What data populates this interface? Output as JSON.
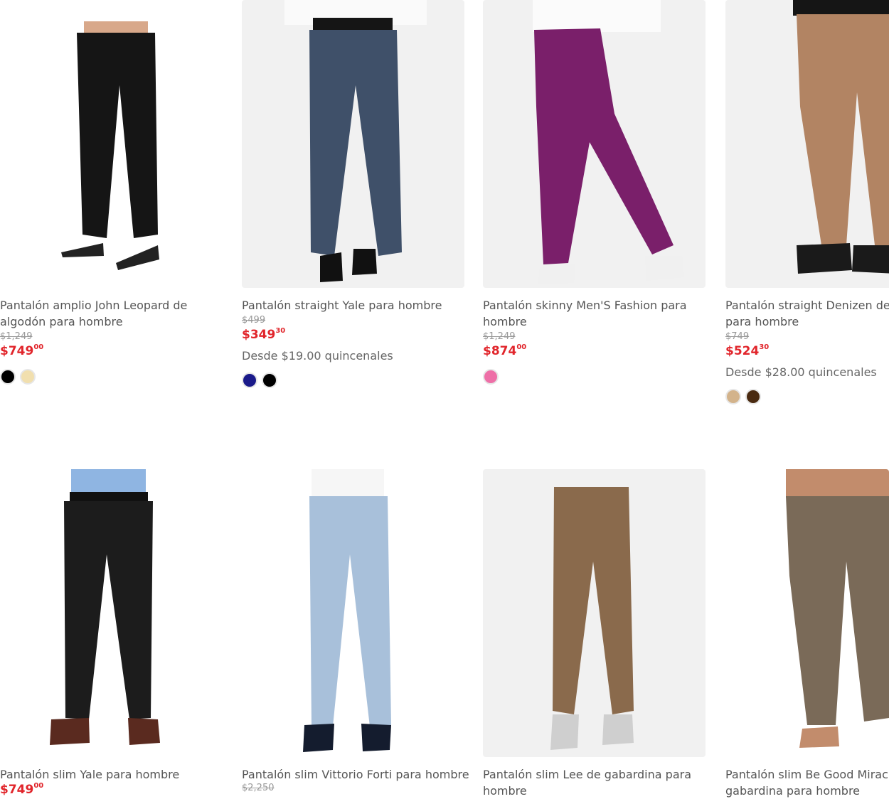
{
  "products": [
    {
      "title_line1": "Pantalón amplio John Leopard de",
      "title_line2": "algodón para hombre",
      "old_price": "$1,249",
      "price_main": "$749",
      "price_cents": "00",
      "installments": "",
      "swatches": [
        "#000000",
        "#f1dfae"
      ],
      "pants_color": "#151515"
    },
    {
      "title_line1": "Pantalón straight Yale para hombre",
      "title_line2": "",
      "old_price": "$499",
      "price_main": "$349",
      "price_cents": "30",
      "installments": "Desde $19.00 quincenales",
      "swatches": [
        "#1a1a8a",
        "#000000"
      ],
      "pants_color": "#3f5069"
    },
    {
      "title_line1": "Pantalón skinny Men'S Fashion para",
      "title_line2": "hombre",
      "old_price": "$1,249",
      "price_main": "$874",
      "price_cents": "00",
      "installments": "",
      "swatches": [
        "#ee6fa7"
      ],
      "pants_color": "#7a1f6a"
    },
    {
      "title_line1": "Pantalón straight Denizen de g",
      "title_line2": "para hombre",
      "old_price": "$749",
      "price_main": "$524",
      "price_cents": "30",
      "installments": "Desde $28.00 quincenales",
      "swatches": [
        "#d3b38b",
        "#4a2a10"
      ],
      "pants_color": "#b28463"
    },
    {
      "title_line1": "Pantalón slim Yale para hombre",
      "title_line2": "",
      "old_price": "",
      "price_main": "$749",
      "price_cents": "00",
      "installments": "",
      "swatches": [],
      "pants_color": "#1c1c1c"
    },
    {
      "title_line1": "Pantalón slim Vittorio Forti para hombre",
      "title_line2": "",
      "old_price": "$2,250",
      "price_main": "",
      "price_cents": "",
      "installments": "",
      "swatches": [],
      "pants_color": "#a8c0da"
    },
    {
      "title_line1": "Pantalón slim Lee de gabardina para",
      "title_line2": "hombre",
      "old_price": "",
      "price_main": "",
      "price_cents": "",
      "installments": "",
      "swatches": [],
      "pants_color": "#8a6a4c"
    },
    {
      "title_line1": "Pantalón slim Be Good Miracle",
      "title_line2": "gabardina para hombre",
      "old_price": "",
      "price_main": "",
      "price_cents": "",
      "installments": "",
      "swatches": [],
      "pants_color": "#7a6a58"
    }
  ]
}
